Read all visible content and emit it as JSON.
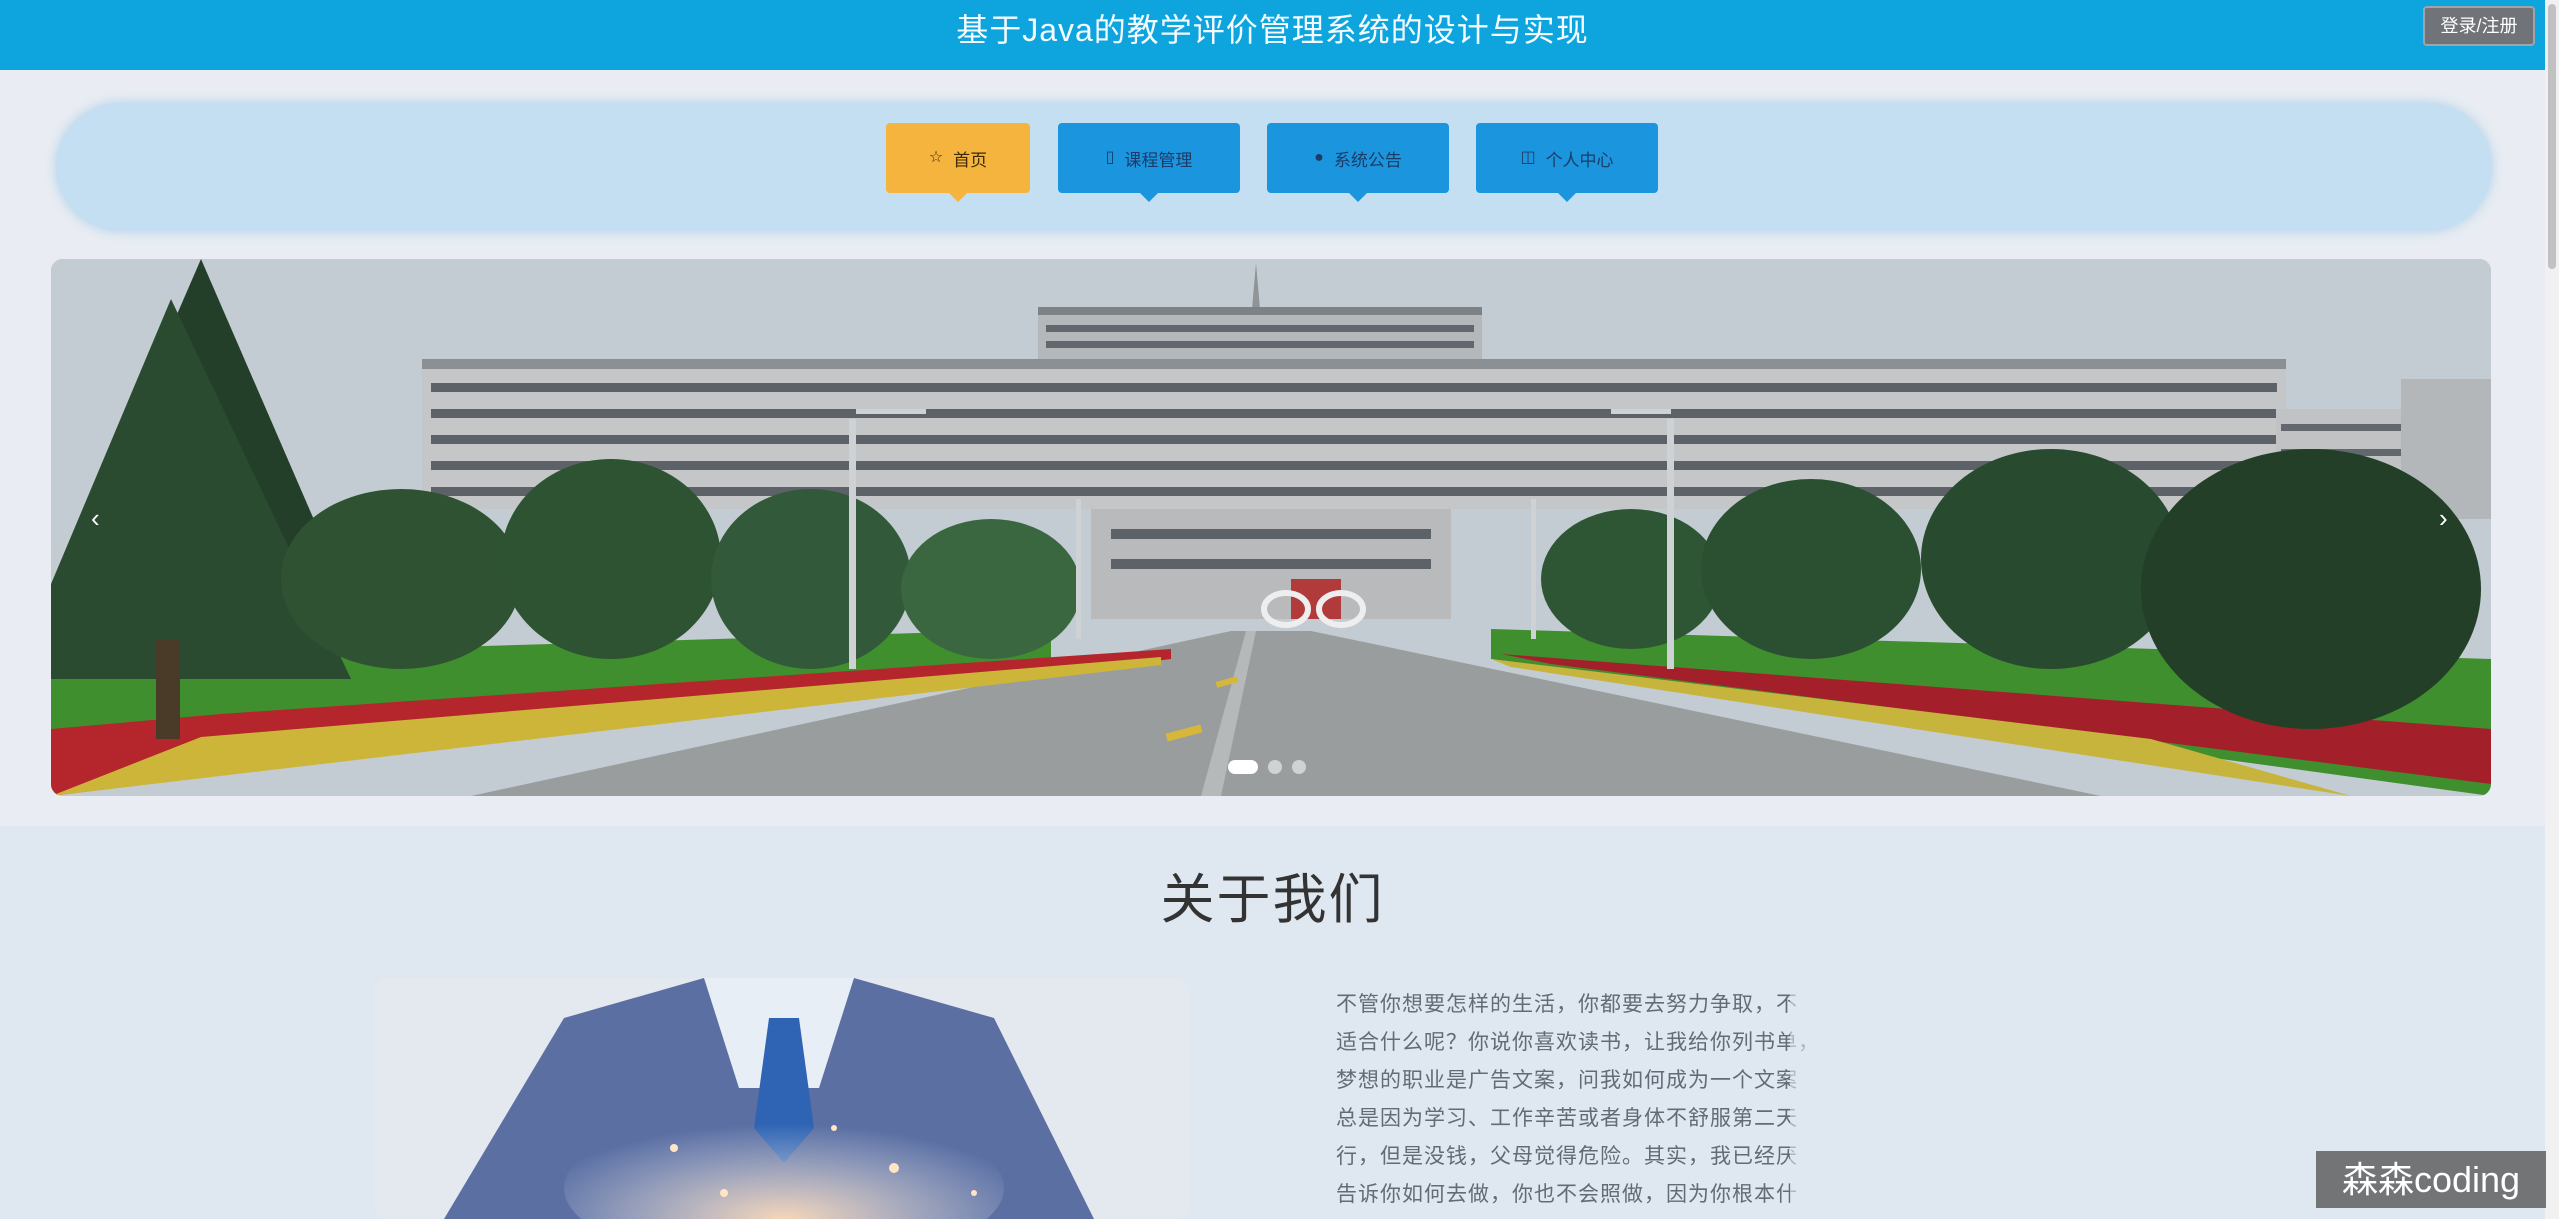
{
  "header": {
    "title": "基于Java的教学评价管理系统的设计与实现",
    "login_label": "登录/注册"
  },
  "nav": {
    "items": [
      {
        "label": "首页",
        "icon": "star-icon",
        "active": true
      },
      {
        "label": "课程管理",
        "icon": "book-icon",
        "active": false
      },
      {
        "label": "系统公告",
        "icon": "info-icon",
        "active": false
      },
      {
        "label": "个人中心",
        "icon": "user-icon",
        "active": false
      }
    ]
  },
  "carousel": {
    "prev_glyph": "‹",
    "next_glyph": "›",
    "slide_count": 3,
    "active_slide": 1
  },
  "about": {
    "title": "关于我们",
    "lines": [
      "不管你想要怎样的生活，你都要去努力争取，不",
      "适合什么呢？你说你喜欢读书，让我给你列书单，",
      "梦想的职业是广告文案，问我如何成为一个文案",
      "总是因为学习、工作辛苦或者身体不舒服第二天",
      "行，但是没钱，父母觉得危险。其实，我已经厌",
      "告诉你如何去做，你也不会照做，因为你根本什"
    ]
  },
  "watermark": "森森coding",
  "colors": {
    "topbar": "#0ea5df",
    "nav_active": "#f5b43e",
    "nav_inactive": "#1b95dd",
    "nav_band": "#c5dff2"
  }
}
